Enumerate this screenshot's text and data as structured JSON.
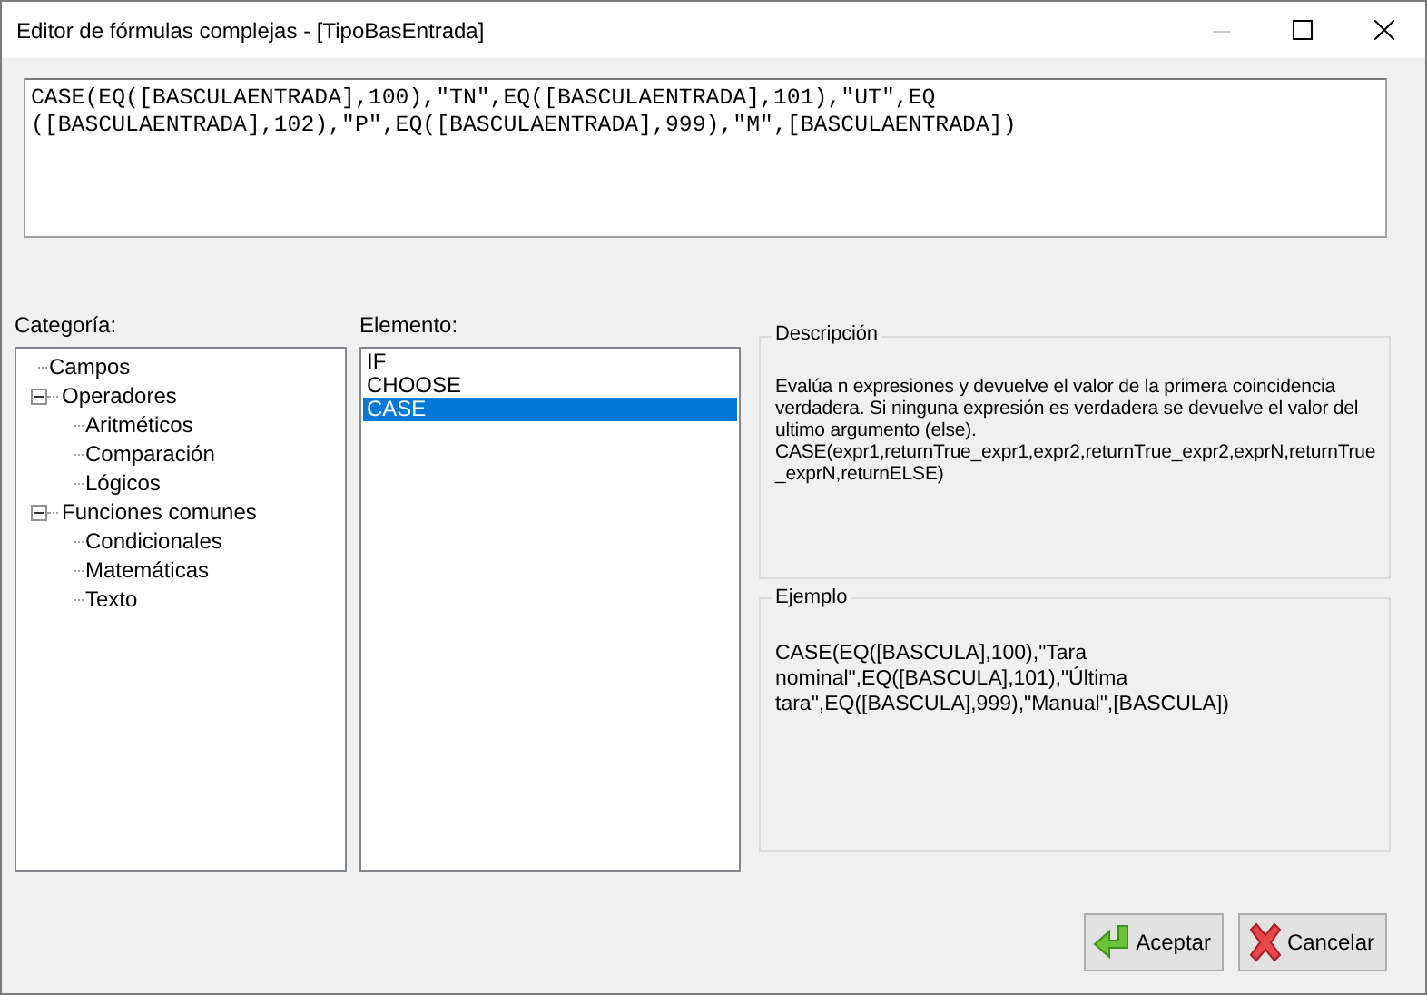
{
  "window": {
    "title": "Editor de fórmulas complejas - [TipoBasEntrada]",
    "minimize_disabled": true
  },
  "formula": {
    "lines": [
      "CASE(EQ([BASCULAENTRADA],100),\"TN\",EQ([BASCULAENTRADA],101),\"UT\",EQ",
      "([BASCULAENTRADA],102),\"P\",EQ([BASCULAENTRADA],999),\"M\",[BASCULAENTRADA])"
    ]
  },
  "category": {
    "label": "Categoría:",
    "items": [
      {
        "label": "Campos"
      },
      {
        "label": "Operadores",
        "expanded": true,
        "children": [
          {
            "label": "Aritméticos"
          },
          {
            "label": "Comparación"
          },
          {
            "label": "Lógicos"
          }
        ]
      },
      {
        "label": "Funciones comunes",
        "expanded": true,
        "children": [
          {
            "label": "Condicionales"
          },
          {
            "label": "Matemáticas"
          },
          {
            "label": "Texto"
          }
        ]
      }
    ]
  },
  "element": {
    "label": "Elemento:",
    "items": [
      {
        "label": "IF",
        "selected": false
      },
      {
        "label": "CHOOSE",
        "selected": false
      },
      {
        "label": "CASE",
        "selected": true
      }
    ]
  },
  "description": {
    "title": "Descripción",
    "paragraphs": [
      "Evalúa n expresiones y devuelve el valor de la primera coincidencia verdadera. Si ninguna expresión es verdadera se devuelve el valor del ultimo argumento (else).",
      "CASE(expr1,returnTrue_expr1,expr2,returnTrue_expr2,exprN,returnTrue_exprN,returnELSE)"
    ]
  },
  "example": {
    "title": "Ejemplo",
    "text": "CASE(EQ([BASCULA],100),\"Tara nominal\",EQ([BASCULA],101),\"Última tara\",EQ([BASCULA],999),\"Manual\",[BASCULA])"
  },
  "buttons": [
    {
      "kind": "accept",
      "label": "Aceptar"
    },
    {
      "kind": "cancel",
      "label": "Cancelar"
    }
  ]
}
